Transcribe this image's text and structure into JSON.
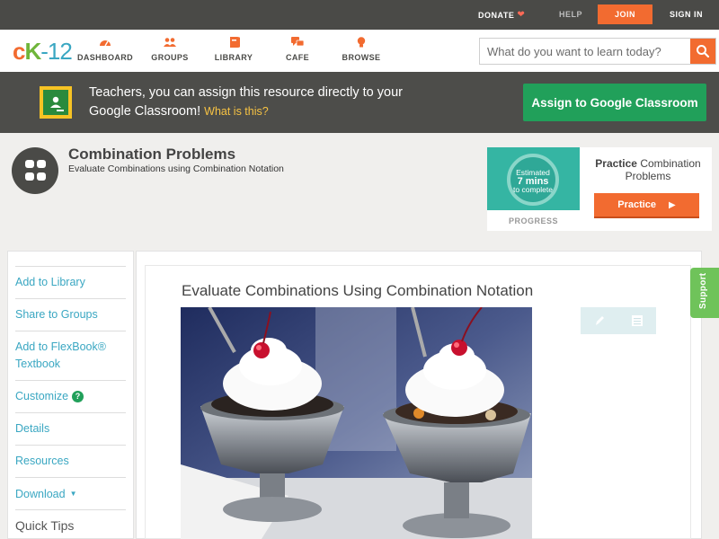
{
  "topbar": {
    "donate": "DONATE",
    "help": "HELP",
    "join": "JOIN",
    "signin": "SIGN IN"
  },
  "logo": {
    "c": "c",
    "k": "K",
    "rest": "-12"
  },
  "nav": {
    "items": [
      {
        "label": "DASHBOARD",
        "icon": "dashboard-gauge-icon"
      },
      {
        "label": "GROUPS",
        "icon": "groups-people-icon"
      },
      {
        "label": "LIBRARY",
        "icon": "library-book-icon"
      },
      {
        "label": "CAFE",
        "icon": "cafe-chat-icon"
      },
      {
        "label": "BROWSE",
        "icon": "browse-bulb-icon"
      }
    ],
    "search_placeholder": "What do you want to learn today?"
  },
  "google_banner": {
    "message": "Teachers, you can assign this resource directly to your Google Classroom!",
    "what_link": "What is this?",
    "assign_button": "Assign to Google Classroom"
  },
  "concept": {
    "title": "Combination Problems",
    "subtitle": "Evaluate Combinations using Combination Notation"
  },
  "practice": {
    "estimate_line1": "Estimated",
    "estimate_mins": "7 mins",
    "estimate_line3": "to complete",
    "progress_label": "PROGRESS",
    "title_bold": "Practice",
    "title_rest": " Combination Problems",
    "button": "Practice"
  },
  "sidebar": {
    "add_library": "Add to Library",
    "share_groups": "Share to Groups",
    "add_flexbook": "Add to FlexBook®",
    "flexbook_textbook": "Textbook",
    "customize": "Customize",
    "details": "Details",
    "resources": "Resources",
    "download": "Download",
    "quick_tips": "Quick Tips"
  },
  "article": {
    "title": "Evaluate Combinations Using Combination Notation"
  },
  "support_tab": "Support",
  "colors": {
    "accent_orange": "#f26b30",
    "google_green": "#21a05a",
    "link_blue": "#3aa7c2",
    "progress_teal": "#35b5a3",
    "support_green": "#6fc35a"
  }
}
